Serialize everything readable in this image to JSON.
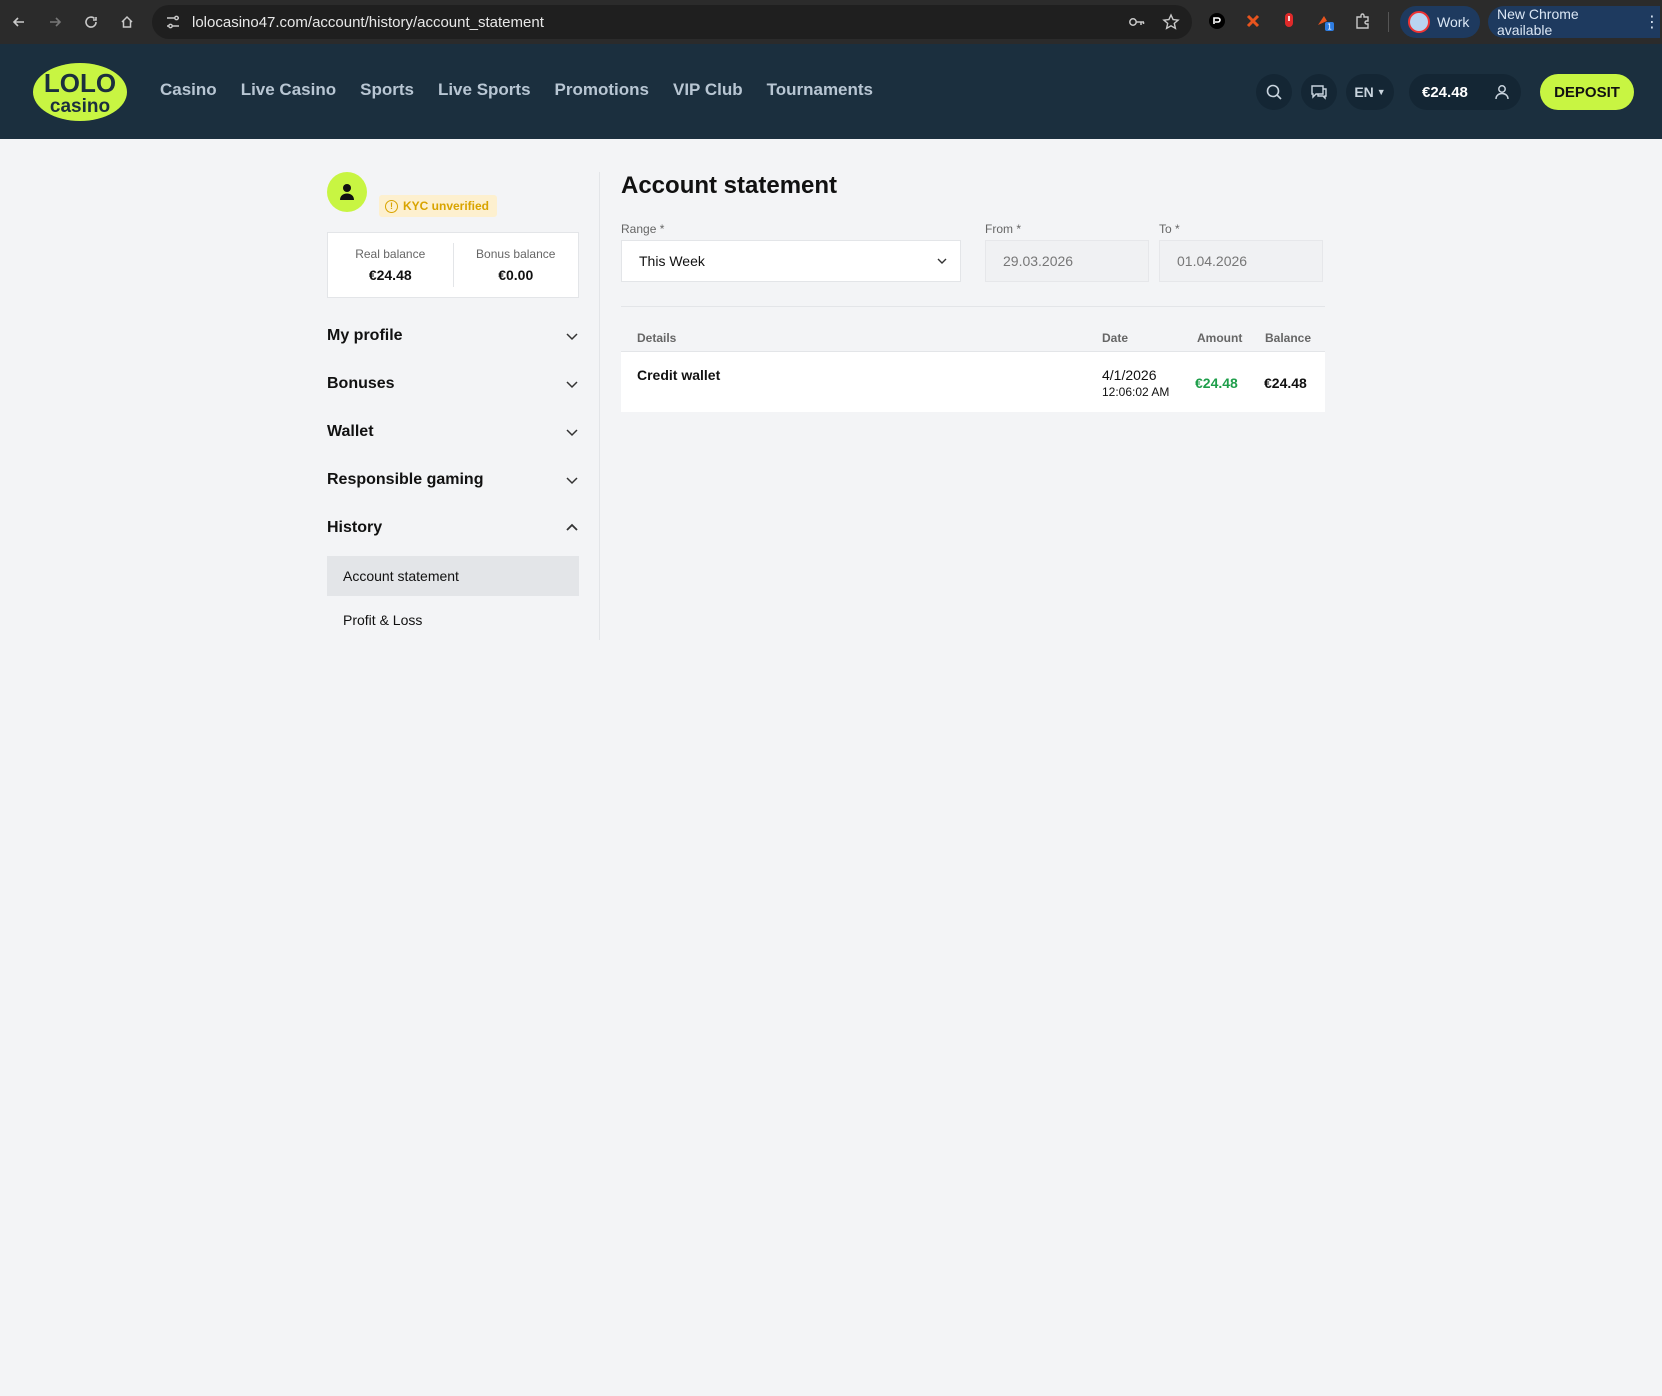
{
  "browser": {
    "url": "lolocasino47.com/account/history/account_statement",
    "profile_label": "Work",
    "update_label": "New Chrome available",
    "ext_badge": "1"
  },
  "header": {
    "logo_top": "LOLO",
    "logo_bottom": "casino",
    "nav": [
      "Casino",
      "Live Casino",
      "Sports",
      "Live Sports",
      "Promotions",
      "VIP Club",
      "Tournaments"
    ],
    "lang": "EN",
    "balance": "€24.48",
    "deposit_label": "DEPOSIT"
  },
  "sidebar": {
    "kyc_label": "KYC unverified",
    "real_balance_label": "Real balance",
    "real_balance_value": "€24.48",
    "bonus_balance_label": "Bonus balance",
    "bonus_balance_value": "€0.00",
    "menu": [
      "My profile",
      "Bonuses",
      "Wallet",
      "Responsible gaming",
      "History"
    ],
    "history_sub": [
      "Account statement",
      "Profit & Loss"
    ]
  },
  "main": {
    "title": "Account statement",
    "range_label": "Range *",
    "range_value": "This Week",
    "from_label": "From *",
    "from_value": "29.03.2026",
    "to_label": "To *",
    "to_value": "01.04.2026",
    "columns": [
      "Details",
      "Date",
      "Amount",
      "Balance"
    ],
    "rows": [
      {
        "details": "Credit wallet",
        "date": "4/1/2026",
        "time": "12:06:02 AM",
        "amount": "€24.48",
        "balance": "€24.48"
      }
    ]
  },
  "colors": {
    "header_bg": "#1b2f3e",
    "accent": "#c8f542",
    "amount_positive": "#1e9e4a",
    "kyc_warning": "#d9a400"
  }
}
